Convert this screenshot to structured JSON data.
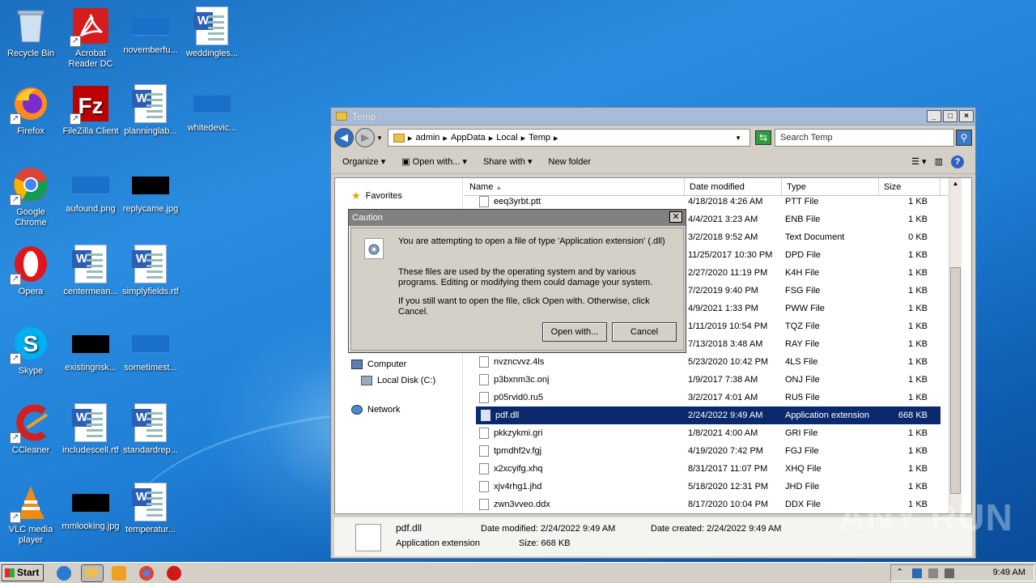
{
  "desktop": {
    "icons": [
      {
        "label": "Recycle Bin"
      },
      {
        "label": "Acrobat Reader DC"
      },
      {
        "label": "novemberfu..."
      },
      {
        "label": "weddingles..."
      },
      {
        "label": "Firefox"
      },
      {
        "label": "FileZilla Client"
      },
      {
        "label": "planninglab..."
      },
      {
        "label": "whitedevic..."
      },
      {
        "label": "Google Chrome"
      },
      {
        "label": "aufound.png"
      },
      {
        "label": "replycame.jpg"
      },
      {
        "label": "Opera"
      },
      {
        "label": "centermean..."
      },
      {
        "label": "simplyfields.rtf"
      },
      {
        "label": "Skype"
      },
      {
        "label": "existingrisk..."
      },
      {
        "label": "sometimest..."
      },
      {
        "label": "CCleaner"
      },
      {
        "label": "includescell.rtf"
      },
      {
        "label": "standardrep..."
      },
      {
        "label": "VLC media player"
      },
      {
        "label": "mmlooking.jpg"
      },
      {
        "label": "temperatur..."
      }
    ],
    "watermark": "ANY RUN"
  },
  "explorer": {
    "title": "Temp",
    "breadcrumb": [
      "admin",
      "AppData",
      "Local",
      "Temp"
    ],
    "search_placeholder": "Search Temp",
    "toolbar": {
      "organize": "Organize",
      "open_with": "Open with...",
      "share_with": "Share with",
      "new_folder": "New folder"
    },
    "nav": {
      "favorites": "Favorites",
      "computer": "Computer",
      "local_disk": "Local Disk (C:)",
      "network": "Network"
    },
    "columns": {
      "name": "Name",
      "date": "Date modified",
      "type": "Type",
      "size": "Size"
    },
    "files": [
      {
        "name": "eeq3yrbt.ptt",
        "date": "4/18/2018 4:26 AM",
        "type": "PTT File",
        "size": "1 KB"
      },
      {
        "name": "",
        "date": "4/4/2021 3:23 AM",
        "type": "ENB File",
        "size": "1 KB"
      },
      {
        "name": "",
        "date": "3/2/2018 9:52 AM",
        "type": "Text Document",
        "size": "0 KB"
      },
      {
        "name": "",
        "date": "11/25/2017 10:30 PM",
        "type": "DPD File",
        "size": "1 KB"
      },
      {
        "name": "",
        "date": "2/27/2020 11:19 PM",
        "type": "K4H File",
        "size": "1 KB"
      },
      {
        "name": "",
        "date": "7/2/2019 9:40 PM",
        "type": "FSG File",
        "size": "1 KB"
      },
      {
        "name": "",
        "date": "4/9/2021 1:33 PM",
        "type": "PWW File",
        "size": "1 KB"
      },
      {
        "name": "",
        "date": "1/11/2019 10:54 PM",
        "type": "TQZ File",
        "size": "1 KB"
      },
      {
        "name": "",
        "date": "7/13/2018 3:48 AM",
        "type": "RAY File",
        "size": "1 KB"
      },
      {
        "name": "nvzncvvz.4ls",
        "date": "5/23/2020 10:42 PM",
        "type": "4LS File",
        "size": "1 KB"
      },
      {
        "name": "p3bxnm3c.onj",
        "date": "1/9/2017 7:38 AM",
        "type": "ONJ File",
        "size": "1 KB"
      },
      {
        "name": "p05rvid0.ru5",
        "date": "3/2/2017 4:01 AM",
        "type": "RU5 File",
        "size": "1 KB"
      },
      {
        "name": "pdf.dll",
        "date": "2/24/2022 9:49 AM",
        "type": "Application extension",
        "size": "668 KB"
      },
      {
        "name": "pkkzykmi.gri",
        "date": "1/8/2021 4:00 AM",
        "type": "GRI File",
        "size": "1 KB"
      },
      {
        "name": "tpmdhf2v.fgj",
        "date": "4/19/2020 7:42 PM",
        "type": "FGJ File",
        "size": "1 KB"
      },
      {
        "name": "x2xcyifg.xhq",
        "date": "8/31/2017 11:07 PM",
        "type": "XHQ File",
        "size": "1 KB"
      },
      {
        "name": "xjv4rhg1.jhd",
        "date": "5/18/2020 12:31 PM",
        "type": "JHD File",
        "size": "1 KB"
      },
      {
        "name": "zwn3vveo.ddx",
        "date": "8/17/2020 10:04 PM",
        "type": "DDX File",
        "size": "1 KB"
      }
    ],
    "status": {
      "name": "pdf.dll",
      "type": "Application extension",
      "date_modified": "Date modified: 2/24/2022 9:49 AM",
      "date_created": "Date created: 2/24/2022 9:49 AM",
      "size": "Size: 668 KB"
    }
  },
  "dialog": {
    "title": "Caution",
    "line1": "You are attempting to open a file of type 'Application extension' (.dll)",
    "line2": "These files are used by the operating system and by various programs. Editing or modifying them could damage your system.",
    "line3": "If you still want to open the file, click Open with. Otherwise, click Cancel.",
    "open_with": "Open with...",
    "cancel": "Cancel"
  },
  "taskbar": {
    "start": "Start",
    "clock": "9:49 AM"
  }
}
